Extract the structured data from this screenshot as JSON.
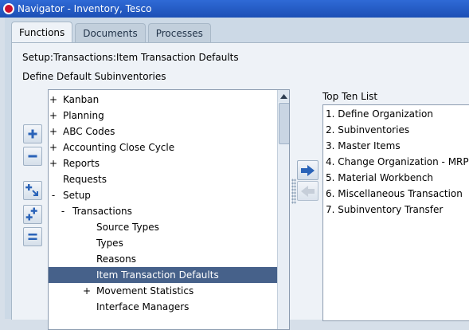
{
  "window": {
    "title": "Navigator - Inventory, Tesco"
  },
  "tabs": [
    {
      "label": "Functions",
      "active": true
    },
    {
      "label": "Documents",
      "active": false
    },
    {
      "label": "Processes",
      "active": false
    }
  ],
  "breadcrumb": "Setup:Transactions:Item Transaction Defaults",
  "section_label": "Define Default Subinventories",
  "tree": {
    "items": [
      {
        "expander": "+",
        "label": "Kanban",
        "level": 0,
        "selected": false
      },
      {
        "expander": "+",
        "label": "Planning",
        "level": 0,
        "selected": false
      },
      {
        "expander": "+",
        "label": "ABC Codes",
        "level": 0,
        "selected": false
      },
      {
        "expander": "+",
        "label": "Accounting Close Cycle",
        "level": 0,
        "selected": false
      },
      {
        "expander": "+",
        "label": "Reports",
        "level": 0,
        "selected": false
      },
      {
        "expander": "",
        "label": "Requests",
        "level": 0,
        "selected": false
      },
      {
        "expander": "-",
        "label": "Setup",
        "level": 0,
        "selected": false
      },
      {
        "expander": "-",
        "label": "Transactions",
        "level": 1,
        "selected": false
      },
      {
        "expander": "",
        "label": "Source Types",
        "level": 2,
        "selected": false
      },
      {
        "expander": "",
        "label": "Types",
        "level": 2,
        "selected": false
      },
      {
        "expander": "",
        "label": "Reasons",
        "level": 2,
        "selected": false
      },
      {
        "expander": "",
        "label": "Item Transaction Defaults",
        "level": 2,
        "selected": true
      },
      {
        "expander": "+",
        "label": "Movement Statistics",
        "level": 2,
        "selected": false
      },
      {
        "expander": "",
        "label": "Interface Managers",
        "level": 2,
        "selected": false
      }
    ]
  },
  "top_ten": {
    "label": "Top Ten List",
    "items": [
      "1. Define Organization",
      "2. Subinventories",
      "3. Master Items",
      "4. Change Organization - MRP",
      "5. Material Workbench",
      "6. Miscellaneous Transaction",
      "7. Subinventory Transfer"
    ]
  },
  "icons": {
    "expand": "plus-icon",
    "collapse": "minus-icon",
    "expand_all": "expand-all-icon",
    "expand_branch": "expand-branch-icon",
    "collapse_all": "collapse-all-icon",
    "add_to_top_ten": "right-arrow-icon",
    "remove_from_top_ten": "left-arrow-icon"
  },
  "colors": {
    "title_bar": "#2f6ad6",
    "selected_row": "#46618a",
    "panel": "#eef2f7",
    "button_icon": "#2a63b8"
  }
}
